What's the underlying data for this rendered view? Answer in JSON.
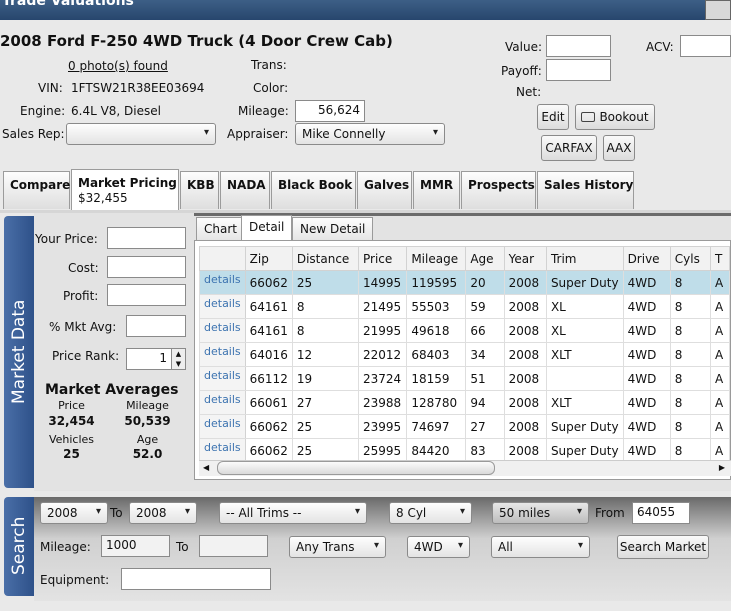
{
  "window": {
    "title": "Trade Valuations"
  },
  "vehicle": {
    "title": "2008 Ford F-250  4WD Truck (4 Door Crew Cab)",
    "photos_link": "0 photo(s) found",
    "vin_label": "VIN:",
    "vin": "1FTSW21R38EE03694",
    "engine_label": "Engine:",
    "engine": "6.4L V8, Diesel",
    "sales_rep_label": "Sales Rep:",
    "sales_rep": "",
    "trans_label": "Trans:",
    "color_label": "Color:",
    "mileage_label": "Mileage:",
    "mileage": "56,624",
    "appraiser_label": "Appraiser:",
    "appraiser": "Mike Connelly"
  },
  "valuation": {
    "value_label": "Value:",
    "payoff_label": "Payoff:",
    "net_label": "Net:",
    "acv_label": "ACV:"
  },
  "actions": {
    "edit": "Edit",
    "bookout": "Bookout",
    "carfax": "CARFAX",
    "aax": "AAX"
  },
  "tabs": [
    {
      "label": "Compare"
    },
    {
      "label": "Market Pricing",
      "sub": "$32,455"
    },
    {
      "label": "KBB"
    },
    {
      "label": "NADA"
    },
    {
      "label": "Black Book"
    },
    {
      "label": "Galves"
    },
    {
      "label": "MMR"
    },
    {
      "label": "Prospects"
    },
    {
      "label": "Sales History"
    }
  ],
  "market_data": {
    "side_label": "Market Data",
    "your_price_label": "Your Price:",
    "cost_label": "Cost:",
    "profit_label": "Profit:",
    "pct_mkt_avg_label": "% Mkt Avg:",
    "price_rank_label": "Price Rank:",
    "price_rank": "1",
    "averages_title": "Market Averages",
    "price_label": "Price",
    "price": "32,454",
    "mileage_label": "Mileage",
    "mileage": "50,539",
    "vehicles_label": "Vehicles",
    "vehicles": "25",
    "age_label": "Age",
    "age": "52.0"
  },
  "subtabs": [
    {
      "label": "Chart"
    },
    {
      "label": "Detail"
    },
    {
      "label": "New Detail"
    }
  ],
  "grid": {
    "link_text": "details",
    "columns": [
      "Zip",
      "Distance",
      "Price",
      "Mileage",
      "Age",
      "Year",
      "Trim",
      "Drive",
      "Cyls",
      "T"
    ],
    "rows": [
      [
        "66062",
        "25",
        "14995",
        "119595",
        "20",
        "2008",
        "Super Duty",
        "4WD",
        "8",
        "A"
      ],
      [
        "64161",
        "8",
        "21495",
        "55503",
        "59",
        "2008",
        "XL",
        "4WD",
        "8",
        "A"
      ],
      [
        "64161",
        "8",
        "21995",
        "49618",
        "66",
        "2008",
        "XL",
        "4WD",
        "8",
        "A"
      ],
      [
        "64016",
        "12",
        "22012",
        "68403",
        "34",
        "2008",
        "XLT",
        "4WD",
        "8",
        "A"
      ],
      [
        "66112",
        "19",
        "23724",
        "18159",
        "51",
        "2008",
        "",
        "4WD",
        "8",
        "A"
      ],
      [
        "66061",
        "27",
        "23988",
        "128780",
        "94",
        "2008",
        "XLT",
        "4WD",
        "8",
        "A"
      ],
      [
        "66062",
        "25",
        "23995",
        "74697",
        "27",
        "2008",
        "Super Duty",
        "4WD",
        "8",
        "A"
      ],
      [
        "66062",
        "25",
        "25995",
        "84420",
        "83",
        "2008",
        "Super Duty",
        "4WD",
        "8",
        "A"
      ]
    ]
  },
  "search": {
    "side_label": "Search",
    "year_from": "2008",
    "to_label": "To",
    "year_to": "2008",
    "trims": "-- All Trims --",
    "cyl": "8 Cyl",
    "radius": "50 miles",
    "from_label": "From",
    "zip": "64055",
    "mileage_label": "Mileage:",
    "mileage_from": "1000",
    "mileage_to_label": "To",
    "mileage_to": "",
    "trans": "Any Trans",
    "drive": "4WD",
    "other": "All",
    "search_button": "Search Market",
    "equipment_label": "Equipment:",
    "equipment": ""
  }
}
